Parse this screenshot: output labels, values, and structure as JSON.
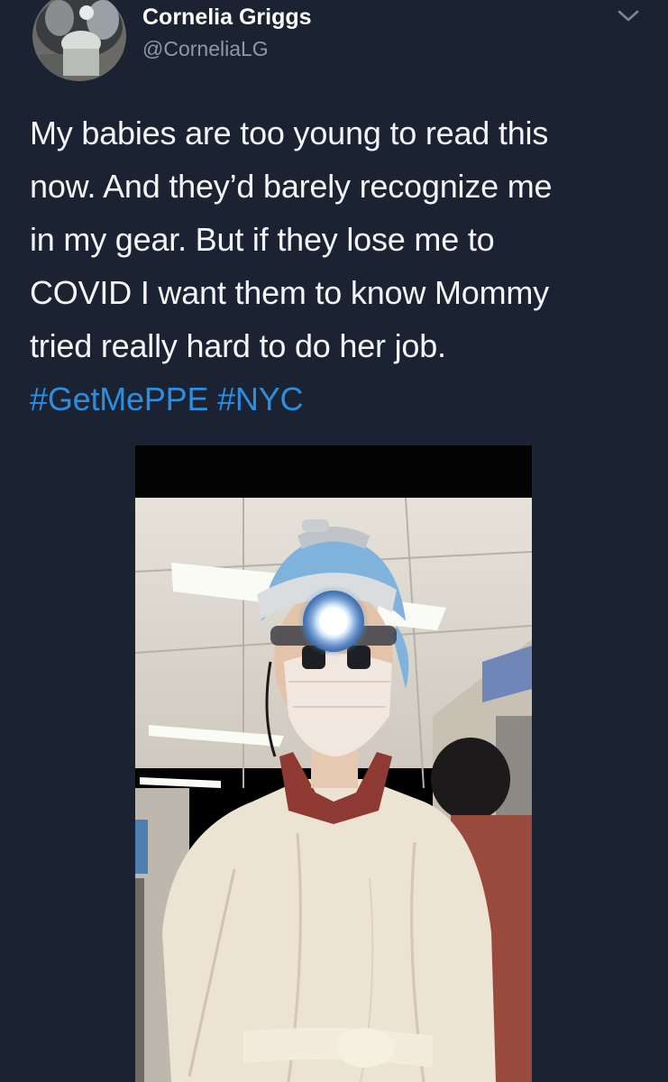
{
  "tweet": {
    "author": {
      "display_name": "Cornelia Griggs",
      "handle": "@CorneliaLG"
    },
    "menu_icon": "chevron-down-icon",
    "text_lines": [
      "My babies are too young to read this",
      "now. And they’d barely recognize me",
      "in my gear. But if they lose me to",
      "COVID I want them to know Mommy",
      "tried really hard to do her job."
    ],
    "hashtags": [
      "#GetMePPE",
      "#NYC"
    ],
    "colors": {
      "background": "#1b2231",
      "text": "#f3f5f8",
      "handle": "#8e99a6",
      "hashtag": "#2b8ee0"
    }
  }
}
